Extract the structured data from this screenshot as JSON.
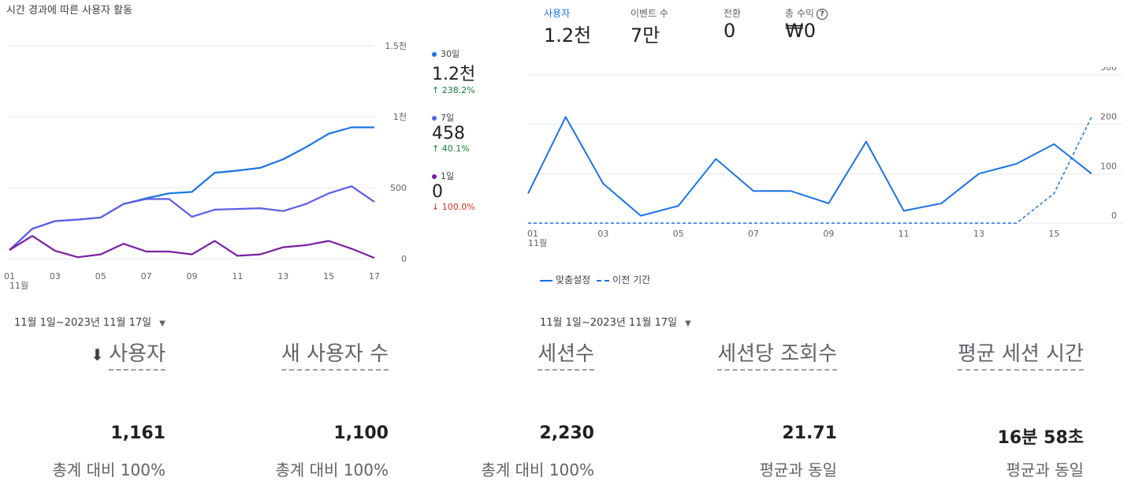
{
  "left_card": {
    "title": "시간 경과에 따른 사용자 활동",
    "date_range": "11월 1일~2023년 11월 17일",
    "y_ticks": [
      "1.5천",
      "1천",
      "500",
      "0"
    ],
    "x_ticks": [
      "01",
      "03",
      "05",
      "07",
      "09",
      "11",
      "13",
      "15",
      "17"
    ],
    "x_month": "11월",
    "legend": [
      {
        "name": "30일",
        "value": "1.2천",
        "delta": "↑ 238.2%",
        "color": "#1a73e8",
        "trend": "up"
      },
      {
        "name": "7일",
        "value": "458",
        "delta": "↑ 40.1%",
        "color": "#5b5fe8",
        "trend": "up"
      },
      {
        "name": "1일",
        "value": "0",
        "delta": "↓ 100.0%",
        "color": "#7b1fa2",
        "trend": "down"
      }
    ]
  },
  "right_card": {
    "metrics": [
      {
        "label": "사용자",
        "value": "1.2천",
        "active": true
      },
      {
        "label": "이벤트 수",
        "value": "7만",
        "active": false
      },
      {
        "label": "전환",
        "value": "0",
        "active": false
      },
      {
        "label": "총 수익",
        "value": "₩0",
        "active": false,
        "help": "?"
      }
    ],
    "y_ticks": [
      "300",
      "200",
      "100",
      "0"
    ],
    "x_ticks": [
      "01",
      "03",
      "05",
      "07",
      "09",
      "11",
      "13",
      "15"
    ],
    "x_month": "11월",
    "legend_current": "맞춤설정",
    "legend_previous": "이전 기간",
    "date_range": "11월 1일~2023년 11월 17일"
  },
  "table": {
    "sort_icon": "arrow-down-icon",
    "columns": [
      {
        "header": "사용자",
        "value": "1,161",
        "sub": "총계 대비 100%"
      },
      {
        "header": "새 사용자 수",
        "value": "1,100",
        "sub": "총계 대비 100%"
      },
      {
        "header": "세션수",
        "value": "2,230",
        "sub": "총계 대비 100%"
      },
      {
        "header": "세션당 조회수",
        "value": "21.71",
        "sub": "평균과 동일"
      },
      {
        "header": "평균 세션 시간",
        "value": "16분 58초",
        "sub": "평균과 동일"
      }
    ]
  },
  "chart_data": [
    {
      "type": "line",
      "title": "시간 경과에 따른 사용자 활동",
      "x": [
        "01",
        "02",
        "03",
        "04",
        "05",
        "06",
        "07",
        "08",
        "09",
        "10",
        "11",
        "12",
        "13",
        "14",
        "15",
        "16",
        "17"
      ],
      "ylim": [
        0,
        1500
      ],
      "yticks": [
        "0",
        "500",
        "1천",
        "1.5천"
      ],
      "grid": true,
      "legend_position": "right",
      "series": [
        {
          "name": "30일",
          "values": [
            60,
            210,
            265,
            275,
            290,
            385,
            425,
            460,
            470,
            605,
            620,
            640,
            700,
            785,
            880,
            925,
            925
          ]
        },
        {
          "name": "7일",
          "values": [
            60,
            210,
            265,
            275,
            290,
            385,
            420,
            420,
            295,
            345,
            350,
            355,
            335,
            385,
            460,
            510,
            400
          ]
        },
        {
          "name": "1일",
          "values": [
            60,
            160,
            55,
            10,
            30,
            105,
            50,
            50,
            30,
            125,
            20,
            30,
            80,
            95,
            125,
            70,
            5
          ]
        }
      ]
    },
    {
      "type": "line",
      "x": [
        "01",
        "02",
        "03",
        "04",
        "05",
        "06",
        "07",
        "08",
        "09",
        "10",
        "11",
        "12",
        "13",
        "14",
        "15",
        "16"
      ],
      "ylim": [
        0,
        300
      ],
      "yticks": [
        "0",
        "100",
        "200",
        "300"
      ],
      "grid": true,
      "legend_position": "bottom-left",
      "series": [
        {
          "name": "맞춤설정",
          "values": [
            60,
            215,
            80,
            15,
            35,
            130,
            65,
            65,
            40,
            165,
            25,
            40,
            100,
            120,
            160,
            100
          ]
        },
        {
          "name": "이전 기간",
          "values": [
            0,
            0,
            0,
            0,
            0,
            0,
            0,
            0,
            0,
            0,
            0,
            0,
            0,
            0,
            60,
            215
          ]
        }
      ]
    }
  ]
}
